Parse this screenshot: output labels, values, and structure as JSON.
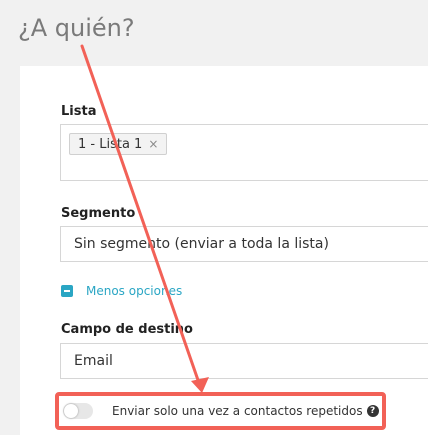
{
  "header": {
    "title": "¿A quién?"
  },
  "form": {
    "lista": {
      "label": "Lista",
      "tags": [
        "1 - Lista 1"
      ],
      "remove_glyph": "×"
    },
    "segmento": {
      "label": "Segmento",
      "value": "Sin segmento (enviar a toda la lista)"
    },
    "options_toggle": {
      "label": "Menos opciones",
      "icon": "minus-square-icon"
    },
    "campo_destino": {
      "label": "Campo de destino",
      "value": "Email"
    },
    "repeat_switch": {
      "label": "Enviar solo una vez a contactos repetidos",
      "checked": false,
      "help_glyph": "?"
    }
  },
  "colors": {
    "accent": "#2aa6c4",
    "annotation": "#f26157",
    "title": "#7a7a7a"
  }
}
